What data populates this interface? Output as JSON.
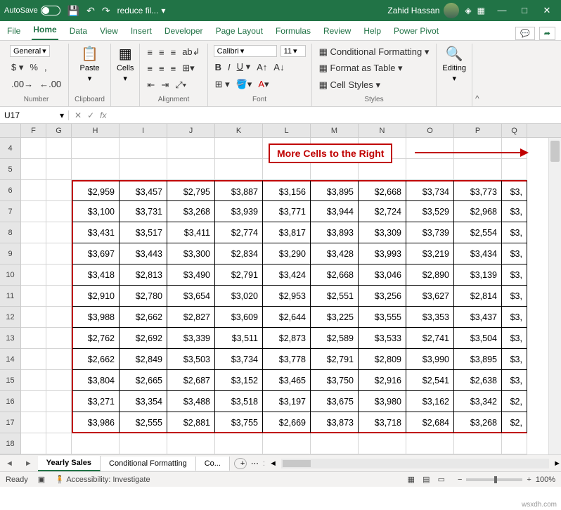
{
  "titlebar": {
    "autosave": "AutoSave",
    "filename": "reduce fil...",
    "user": "Zahid Hassan"
  },
  "tabs": [
    "File",
    "Home",
    "Data",
    "View",
    "Insert",
    "Developer",
    "Page Layout",
    "Formulas",
    "Review",
    "Help",
    "Power Pivot"
  ],
  "active_tab": "Home",
  "ribbon": {
    "number_format": "General",
    "paste": "Paste",
    "cells": "Cells",
    "font_name": "Calibri",
    "font_size": "11",
    "cond_fmt": "Conditional Formatting",
    "fmt_table": "Format as Table",
    "cell_styles": "Cell Styles",
    "editing": "Editing",
    "group_labels": {
      "number": "Number",
      "clipboard": "Clipboard",
      "alignment": "Alignment",
      "font": "Font",
      "styles": "Styles"
    }
  },
  "namebox": "U17",
  "formula": "",
  "annotation": "More Cells to the Right",
  "columns": [
    "F",
    "G",
    "H",
    "I",
    "J",
    "K",
    "L",
    "M",
    "N",
    "O",
    "P",
    "Q"
  ],
  "row_headers": [
    4,
    5,
    6,
    7,
    8,
    9,
    10,
    11,
    12,
    13,
    14,
    15,
    16,
    17,
    18
  ],
  "data": {
    "6": [
      "$2,959",
      "$3,457",
      "$2,795",
      "$3,887",
      "$3,156",
      "$3,895",
      "$2,668",
      "$3,734",
      "$3,773",
      "$3,"
    ],
    "7": [
      "$3,100",
      "$3,731",
      "$3,268",
      "$3,939",
      "$3,771",
      "$3,944",
      "$2,724",
      "$3,529",
      "$2,968",
      "$3,"
    ],
    "8": [
      "$3,431",
      "$3,517",
      "$3,411",
      "$2,774",
      "$3,817",
      "$3,893",
      "$3,309",
      "$3,739",
      "$2,554",
      "$3,"
    ],
    "9": [
      "$3,697",
      "$3,443",
      "$3,300",
      "$2,834",
      "$3,290",
      "$3,428",
      "$3,993",
      "$3,219",
      "$3,434",
      "$3,"
    ],
    "10": [
      "$3,418",
      "$2,813",
      "$3,490",
      "$2,791",
      "$3,424",
      "$2,668",
      "$3,046",
      "$2,890",
      "$3,139",
      "$3,"
    ],
    "11": [
      "$2,910",
      "$2,780",
      "$3,654",
      "$3,020",
      "$2,953",
      "$2,551",
      "$3,256",
      "$3,627",
      "$2,814",
      "$3,"
    ],
    "12": [
      "$3,988",
      "$2,662",
      "$2,827",
      "$3,609",
      "$2,644",
      "$3,225",
      "$3,555",
      "$3,353",
      "$3,437",
      "$3,"
    ],
    "13": [
      "$2,762",
      "$2,692",
      "$3,339",
      "$3,511",
      "$2,873",
      "$2,589",
      "$3,533",
      "$2,741",
      "$3,504",
      "$3,"
    ],
    "14": [
      "$2,662",
      "$2,849",
      "$3,503",
      "$3,734",
      "$3,778",
      "$2,791",
      "$2,809",
      "$3,990",
      "$3,895",
      "$3,"
    ],
    "15": [
      "$3,804",
      "$2,665",
      "$2,687",
      "$3,152",
      "$3,465",
      "$3,750",
      "$2,916",
      "$2,541",
      "$2,638",
      "$3,"
    ],
    "16": [
      "$3,271",
      "$3,354",
      "$3,488",
      "$3,518",
      "$3,197",
      "$3,675",
      "$3,980",
      "$3,162",
      "$3,342",
      "$2,"
    ],
    "17": [
      "$3,986",
      "$2,555",
      "$2,881",
      "$3,755",
      "$2,669",
      "$3,873",
      "$3,718",
      "$2,684",
      "$3,268",
      "$2,"
    ]
  },
  "sheets": [
    "Yearly Sales",
    "Conditional Formatting",
    "Co..."
  ],
  "active_sheet": "Yearly Sales",
  "status": {
    "ready": "Ready",
    "access": "Accessibility: Investigate",
    "zoom": "100%"
  },
  "watermark": "wsxdh.com"
}
